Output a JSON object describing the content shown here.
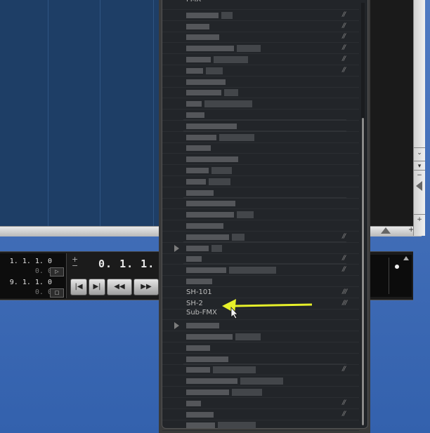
{
  "transport": {
    "left_locator": "1.  1.  1.    0",
    "left_locator_sub": "0.    0",
    "right_locator": "9.  1.  1.    0",
    "right_locator_sub": "0.    0",
    "time_display": "0.  1.  1.",
    "plus_minus": "+\n−",
    "btn_rewind_start": "|◀",
    "btn_forward_end": "▶|",
    "btn_rewind": "◀◀",
    "btn_forward": "▶▶",
    "mini_cycle": "▷",
    "mini_loop": "□"
  },
  "list": {
    "top_label": "FMX",
    "visible_items": [
      {
        "label": "SH-101",
        "mark": "///"
      },
      {
        "label": "SH-2",
        "mark": "///"
      },
      {
        "label": "Sub-FMX",
        "mark": ""
      }
    ]
  },
  "annotation": {
    "arrow_color": "#e6f02a"
  },
  "colors": {
    "desktop": "#3b67b3",
    "arrange_bg": "#1e3e66",
    "list_bg": "#222529"
  }
}
